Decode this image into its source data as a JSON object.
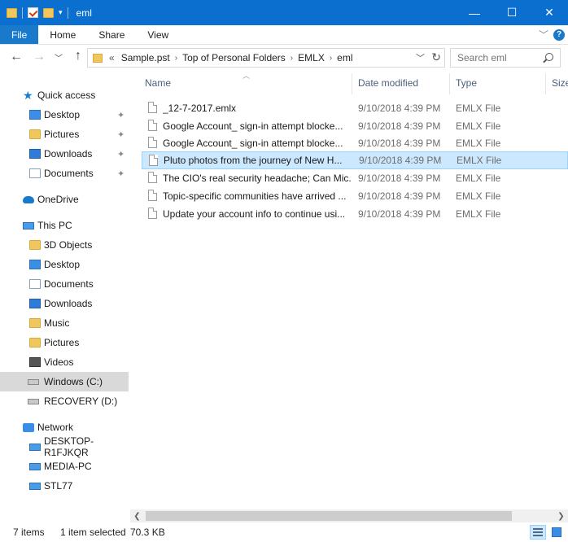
{
  "window": {
    "title": "eml",
    "controls": {
      "minimize": "—",
      "maximize": "☐",
      "close": "✕"
    }
  },
  "ribbon": {
    "tabs": [
      "File",
      "Home",
      "Share",
      "View"
    ],
    "help": "?"
  },
  "address": {
    "overflow": "«",
    "breadcrumbs": [
      "Sample.pst",
      "Top of Personal Folders",
      "EMLX",
      "eml"
    ],
    "separator": "›"
  },
  "search": {
    "placeholder": "Search eml"
  },
  "nav": {
    "quick_access": "Quick access",
    "quick_items": [
      "Desktop",
      "Pictures",
      "Downloads",
      "Documents"
    ],
    "onedrive": "OneDrive",
    "this_pc": "This PC",
    "pc_items": [
      "3D Objects",
      "Desktop",
      "Documents",
      "Downloads",
      "Music",
      "Pictures",
      "Videos",
      "Windows (C:)",
      "RECOVERY (D:)"
    ],
    "network": "Network",
    "network_items": [
      "DESKTOP-R1FJKQR",
      "MEDIA-PC",
      "STL77"
    ]
  },
  "columns": {
    "name": "Name",
    "date": "Date modified",
    "type": "Type",
    "size": "Size"
  },
  "files": [
    {
      "name": "_12-7-2017.emlx",
      "date": "9/10/2018 4:39 PM",
      "type": "EMLX File"
    },
    {
      "name": "Google Account_ sign-in attempt blocke...",
      "date": "9/10/2018 4:39 PM",
      "type": "EMLX File"
    },
    {
      "name": "Google Account_ sign-in attempt blocke...",
      "date": "9/10/2018 4:39 PM",
      "type": "EMLX File"
    },
    {
      "name": "Pluto photos from the journey of New H...",
      "date": "9/10/2018 4:39 PM",
      "type": "EMLX File",
      "selected": true
    },
    {
      "name": "The CIO's real security headache; Can Mic...",
      "date": "9/10/2018 4:39 PM",
      "type": "EMLX File"
    },
    {
      "name": "Topic-specific communities have arrived ...",
      "date": "9/10/2018 4:39 PM",
      "type": "EMLX File"
    },
    {
      "name": "Update your account info to continue usi...",
      "date": "9/10/2018 4:39 PM",
      "type": "EMLX File"
    }
  ],
  "status": {
    "count": "7 items",
    "selected": "1 item selected",
    "size": "70.3 KB"
  },
  "colors": {
    "title_bar": "#0b6fd0",
    "file_tab": "#1979ca",
    "selection": "#cce8ff",
    "selection_border": "#99d1ff",
    "nav_selected": "#d9d9d9"
  }
}
